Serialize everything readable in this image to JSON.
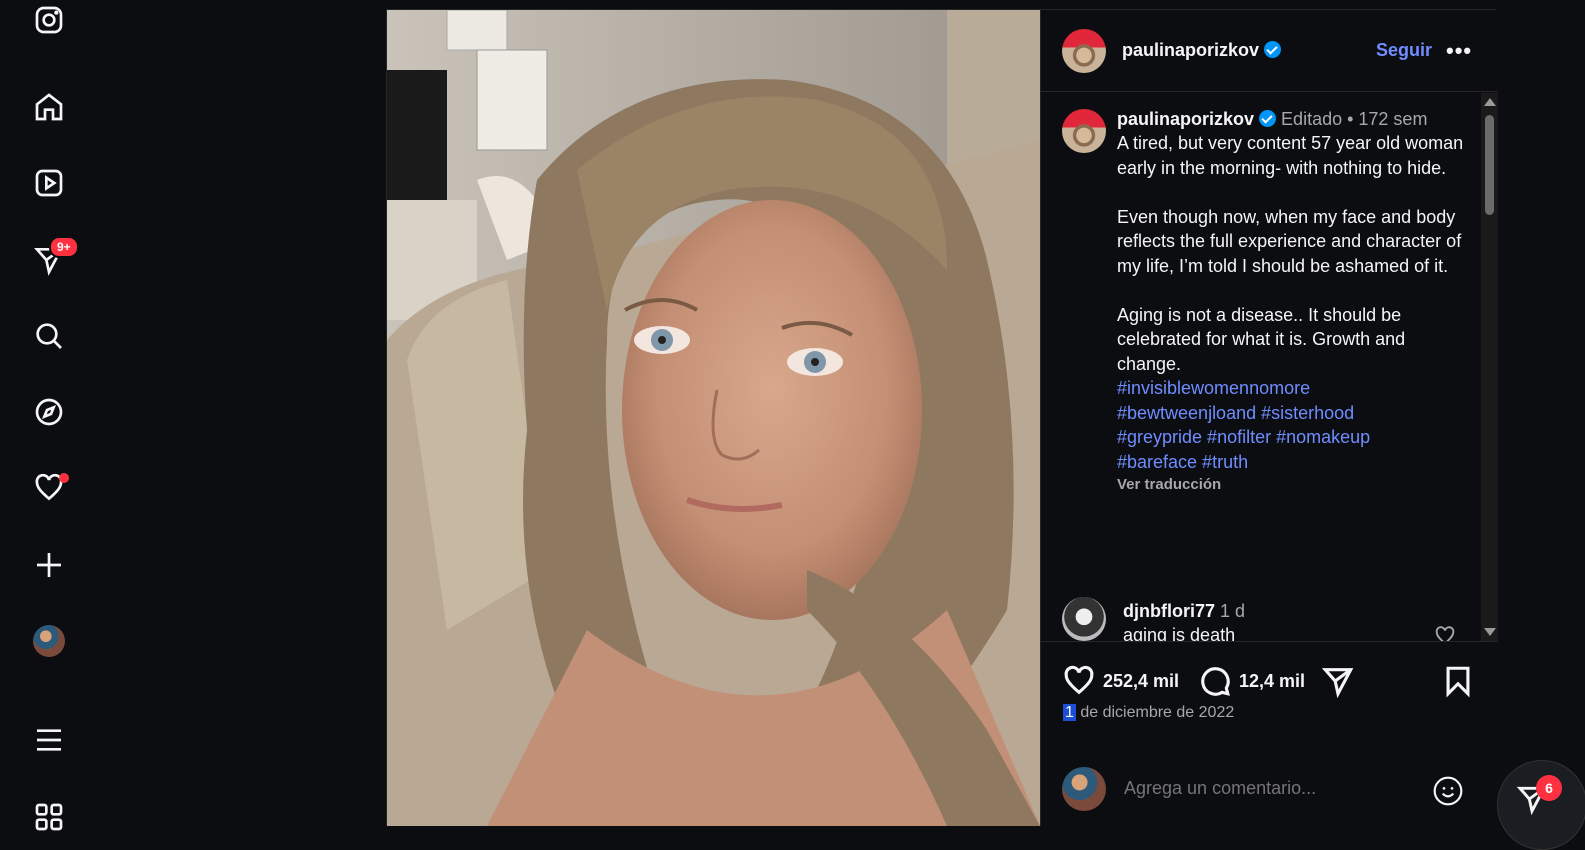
{
  "sidebar": {
    "items": [
      "instagram-logo",
      "home",
      "reels",
      "direct-messages",
      "search",
      "explore",
      "notifications",
      "create",
      "profile",
      "more",
      "also-from-meta"
    ],
    "messages_badge": "9+"
  },
  "post": {
    "author": "paulinaporizkov",
    "follow_label": "Seguir",
    "more_label": "•••",
    "caption_meta": "Editado •  172 sem",
    "caption_text": "A tired, but very content 57 year old woman early in the morning- with nothing to hide.\n\nEven though now, when my face and body reflects the full experience and character of my  life, I’m told I should be ashamed of it.\n\nAging is not a disease.. It should be celebrated for what it is. Growth and change.\n",
    "hashtags_line1": "#invisiblewomennomore",
    "hashtags_line2": "#bewtweenjloand #sisterhood",
    "hashtags_line3": "#greypride #nofilter #nomakeup",
    "hashtags_line4": "#bareface #truth",
    "translate_label": "Ver traducción",
    "comment": {
      "user": "djnbflori77",
      "time": "1 d",
      "text": "aging is death"
    },
    "likes": "252,4 mil",
    "comments_count": "12,4 mil",
    "date_highlight": "1",
    "date_rest": " de diciembre de 2022",
    "comment_placeholder": "Agrega un comentario..."
  },
  "floating": {
    "badge": "6"
  },
  "colors": {
    "accent": "#6f8dff",
    "badge": "#ff3040",
    "verified": "#0095f6"
  }
}
